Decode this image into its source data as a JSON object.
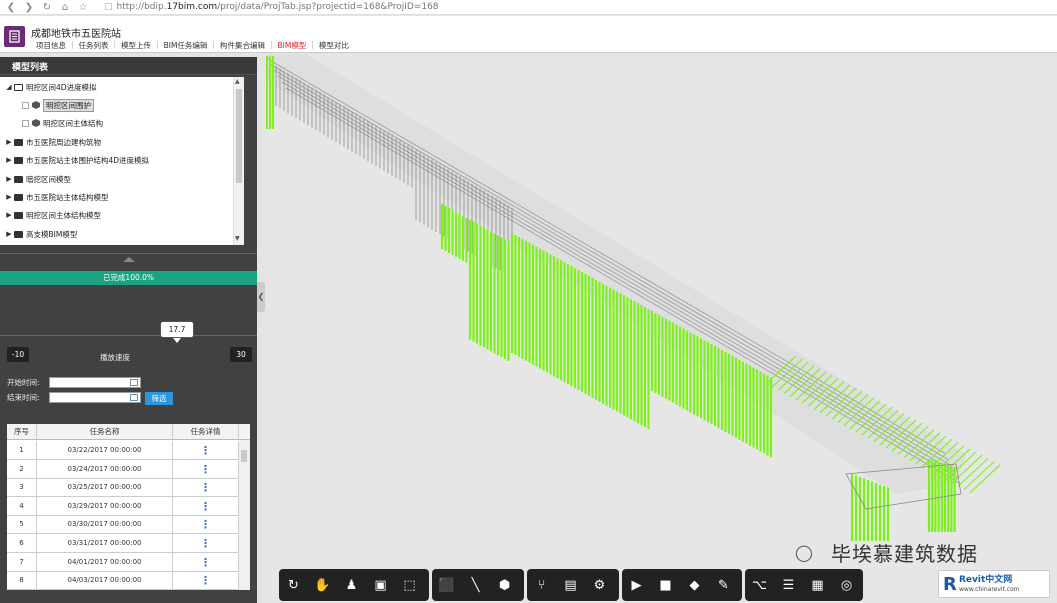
{
  "browser": {
    "url_prefix": "http://bdip.",
    "url_host": "17bim.com",
    "url_path": "/proj/data/ProjTab.jsp?projectid=168&ProjID=168"
  },
  "header": {
    "project_title": "成都地铁市五医院站",
    "nav": [
      "项目信息",
      "任务列表",
      "模型上传",
      "BIM任务编辑",
      "构件集合编辑",
      "BIM模型",
      "模型对比"
    ],
    "active_nav": "BIM模型"
  },
  "left_panel": {
    "title": "模型列表",
    "tree": [
      {
        "label": "明挖区间4D进度模拟",
        "expanded": true
      },
      {
        "label": "明挖区间围护",
        "child": true,
        "highlighted": true
      },
      {
        "label": "明挖区间主体结构",
        "child": true
      },
      {
        "label": "市五医院周边建构筑物",
        "expanded": false
      },
      {
        "label": "市五医院站主体围护结构4D进度模拟",
        "expanded": false
      },
      {
        "label": "暗挖区间模型",
        "expanded": false
      },
      {
        "label": "市五医院站主体结构模型",
        "expanded": false
      },
      {
        "label": "明挖区间主体结构模型",
        "expanded": false
      },
      {
        "label": "高支模BIM模型",
        "expanded": false
      }
    ],
    "progress_label": "已完成100.0%",
    "progress_value": 100.0,
    "speed": {
      "current": "17.7",
      "min": "-10",
      "max": "30",
      "label": "播放速度"
    },
    "start_time_label": "开始时间:",
    "end_time_label": "结束时间:",
    "start_time_value": "",
    "end_time_value": "",
    "filter_label": "筛选",
    "task_table": {
      "headers": [
        "序号",
        "任务名称",
        "任务详情"
      ],
      "rows": [
        {
          "no": "1",
          "name": "03/22/2017 00:00:00"
        },
        {
          "no": "2",
          "name": "03/24/2017 00:00:00"
        },
        {
          "no": "3",
          "name": "03/25/2017 00:00:00"
        },
        {
          "no": "4",
          "name": "03/29/2017 00:00:00"
        },
        {
          "no": "5",
          "name": "03/30/2017 00:00:00"
        },
        {
          "no": "6",
          "name": "03/31/2017 00:00:00"
        },
        {
          "no": "7",
          "name": "04/01/2017 00:00:00"
        },
        {
          "no": "8",
          "name": "04/03/2017 00:00:00"
        }
      ]
    }
  },
  "toolbar": {
    "groups": [
      [
        "orbit-icon",
        "pan-icon",
        "walk-icon",
        "camera-icon",
        "zoom-window-icon"
      ],
      [
        "section-box-icon",
        "measure-icon",
        "explode-icon"
      ],
      [
        "tree-structure-icon",
        "properties-icon",
        "settings-icon"
      ],
      [
        "play-icon",
        "save-icon",
        "paint-icon",
        "pen-icon"
      ],
      [
        "share-icon",
        "report-icon",
        "qrcode-icon",
        "screenshot-icon"
      ]
    ]
  },
  "watermark": {
    "text": "毕埃慕建筑数据",
    "badge_title": "Revit中文网",
    "badge_sub": "www.chinarevit.com"
  },
  "colors": {
    "accent_green": "#1aa383",
    "model_green": "#7cf21a",
    "panel_bg": "#414141",
    "filter_blue": "#2b95dd",
    "active_nav": "#dd2222"
  }
}
